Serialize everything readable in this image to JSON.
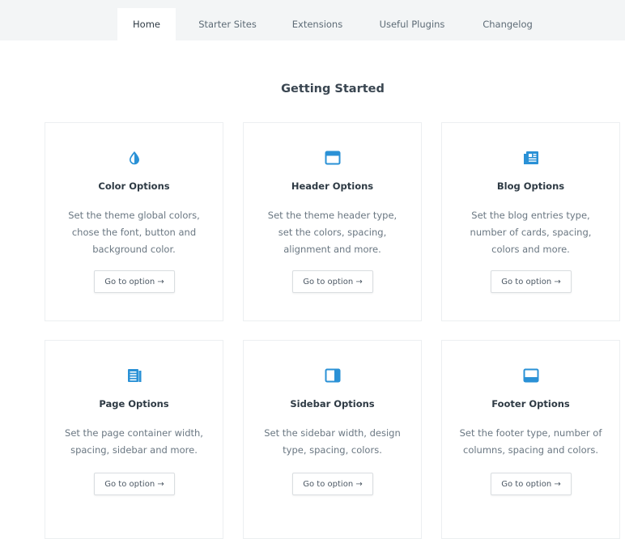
{
  "tabs": [
    {
      "label": "Home",
      "active": true
    },
    {
      "label": "Starter Sites"
    },
    {
      "label": "Extensions"
    },
    {
      "label": "Useful Plugins"
    },
    {
      "label": "Changelog"
    }
  ],
  "section_title": "Getting Started",
  "accent_color": "#2a91d6",
  "cards": [
    {
      "icon": "contrast-drop-icon",
      "title": "Color Options",
      "description": "Set the theme global colors, chose the font, button and background color.",
      "button": "Go to option →"
    },
    {
      "icon": "header-layout-icon",
      "title": "Header Options",
      "description": "Set the theme header type, set the colors, spacing, alignment and more.",
      "button": "Go to option →"
    },
    {
      "icon": "blog-newspaper-icon",
      "title": "Blog Options",
      "description": "Set the blog entries type, number of cards, spacing, colors and more.",
      "button": "Go to option →"
    },
    {
      "icon": "page-document-icon",
      "title": "Page Options",
      "description": "Set the page container width, spacing, sidebar and more.",
      "button": "Go to option →"
    },
    {
      "icon": "sidebar-layout-icon",
      "title": "Sidebar Options",
      "description": "Set the sidebar width, design type, spacing, colors.",
      "button": "Go to option →"
    },
    {
      "icon": "footer-layout-icon",
      "title": "Footer Options",
      "description": "Set the footer type, number of columns, spacing and colors.",
      "button": "Go to option →"
    }
  ]
}
